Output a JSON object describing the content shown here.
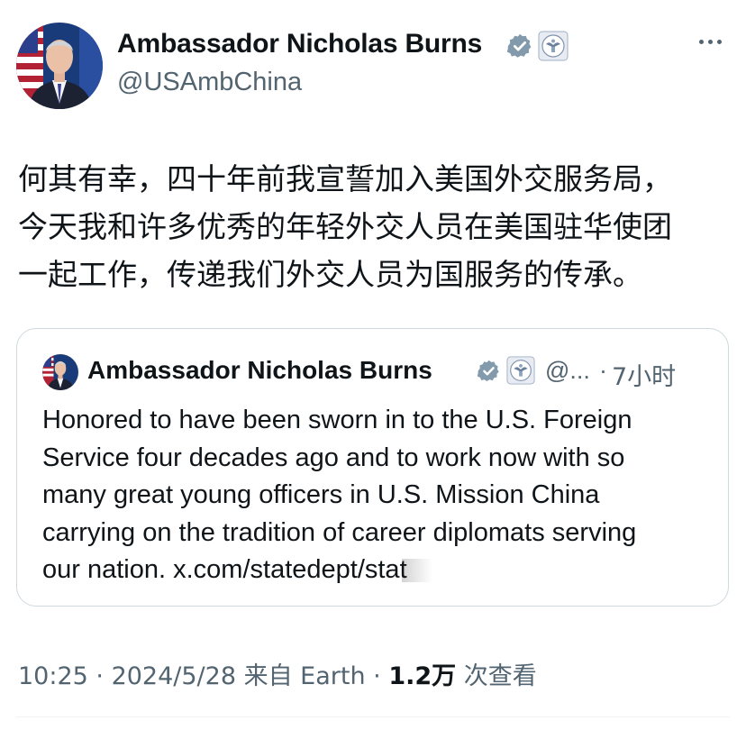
{
  "author": {
    "display_name": "Ambassador Nicholas Burns",
    "handle": "@USAmbChina"
  },
  "tweet": {
    "text_lines": [
      "何其有幸，四十年前我宣誓加入美国外交服务局，",
      "今天我和许多优秀的年轻外交人员在美国驻华使团",
      "一起工作，传递我们外交人员为国服务的传承。"
    ]
  },
  "quote": {
    "display_name": "Ambassador Nicholas Burns",
    "handle_truncated": "@...",
    "separator": "·",
    "time": "7小时",
    "text_lines": [
      "Honored to have been sworn in to the U.S. Foreign",
      "Service four decades ago and to work now with so",
      "many great young officers in U.S. Mission China",
      "carrying on the tradition of career diplomats serving"
    ],
    "last_line_prefix": "our nation. ",
    "link_text": "x.com/statedept/stat"
  },
  "meta": {
    "time": "10:25",
    "sep1": " · ",
    "date": "2024/5/28",
    "source": " 来自 Earth",
    "sep2": " · ",
    "views_count": "1.2万",
    "views_label": " 次查看"
  },
  "icons": {
    "verified": "verified-badge-icon",
    "seal": "state-department-seal-icon",
    "more": "more-options-icon"
  },
  "colors": {
    "verified_badge": "#829aab",
    "secondary_text": "#536471",
    "border": "#cfd9de"
  }
}
